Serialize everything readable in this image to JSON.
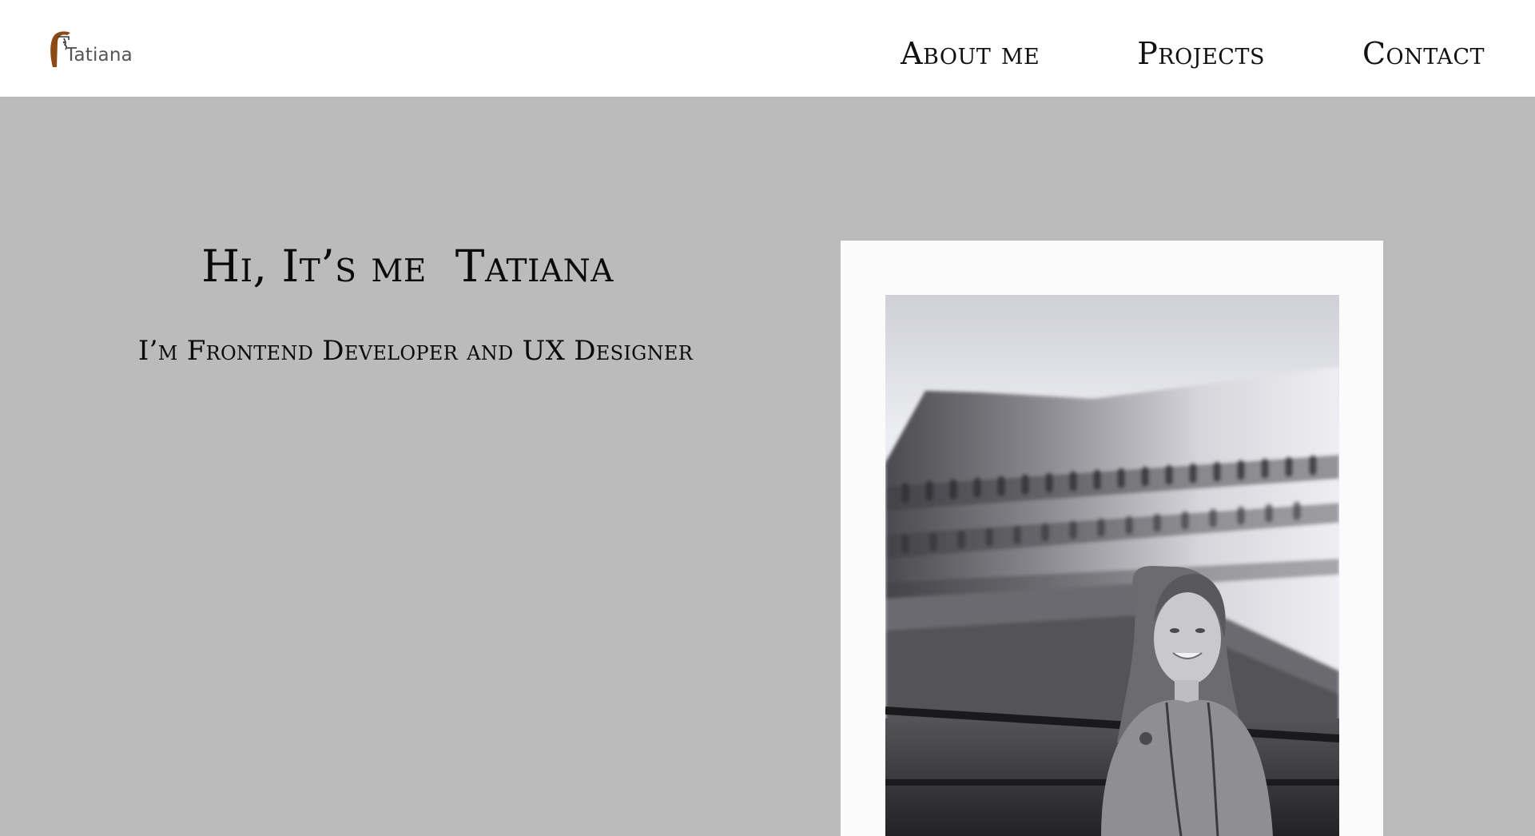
{
  "header": {
    "logo_text": "Tatiana",
    "nav": [
      {
        "label": "About me"
      },
      {
        "label": "Projects"
      },
      {
        "label": "Contact"
      }
    ]
  },
  "hero": {
    "title": "Hi, It’s me  Tatiana",
    "subtitle": "I’m Frontend Developer and UX Designer",
    "photo_icon": "portrait-photo"
  },
  "colors": {
    "header_bg": "#ffffff",
    "hero_bg": "#bbbbbb",
    "frame_bg": "#fbfbfb",
    "logo_accent": "#8b4a16",
    "text": "#0a0a0a"
  }
}
